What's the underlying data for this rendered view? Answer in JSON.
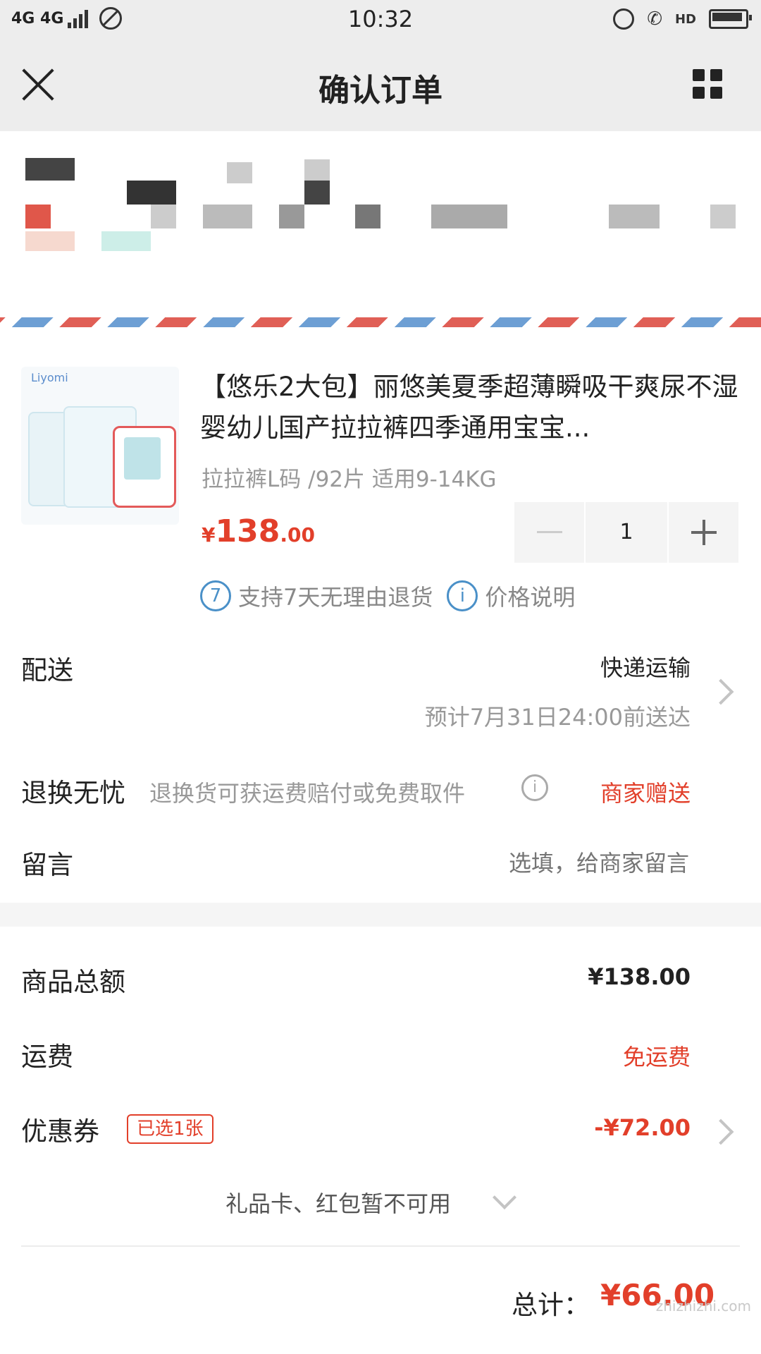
{
  "status_bar": {
    "network": "4G 4G",
    "time": "10:32",
    "hd": "HD"
  },
  "nav": {
    "title": "确认订单"
  },
  "product": {
    "title": "【悠乐2大包】丽悠美夏季超薄瞬吸干爽尿不湿婴幼儿国产拉拉裤四季通用宝宝...",
    "sku": "拉拉裤L码 /92片 适用9-14KG",
    "price_currency": "¥",
    "price_int": "138",
    "price_dec": ".00",
    "quantity": "1",
    "brand_logo": "Liyomi",
    "badge_return_icon": "7",
    "badge_return": "支持7天无理由退货",
    "badge_price_icon": "i",
    "badge_price": "价格说明"
  },
  "delivery": {
    "label": "配送",
    "method": "快递运输",
    "eta": "预计7月31日24:00前送达"
  },
  "returns": {
    "label": "退换无忧",
    "desc": "退换货可获运费赔付或免费取件",
    "value": "商家赠送"
  },
  "message": {
    "label": "留言",
    "placeholder": "选填，给商家留言"
  },
  "summary": {
    "goods_total_label": "商品总额",
    "goods_total_value": "¥138.00",
    "shipping_label": "运费",
    "shipping_value": "免运费",
    "coupon_label": "优惠券",
    "coupon_tag": "已选1张",
    "coupon_value": "-¥72.00",
    "giftcard_text": "礼品卡、红包暂不可用",
    "total_label": "总计：",
    "total_value": "¥66.00"
  },
  "watermark": "zhizhizhi.com",
  "colors": {
    "accent_red": "#e23f2a",
    "badge_blue": "#4a90c8",
    "nav_bg": "#ededed"
  }
}
